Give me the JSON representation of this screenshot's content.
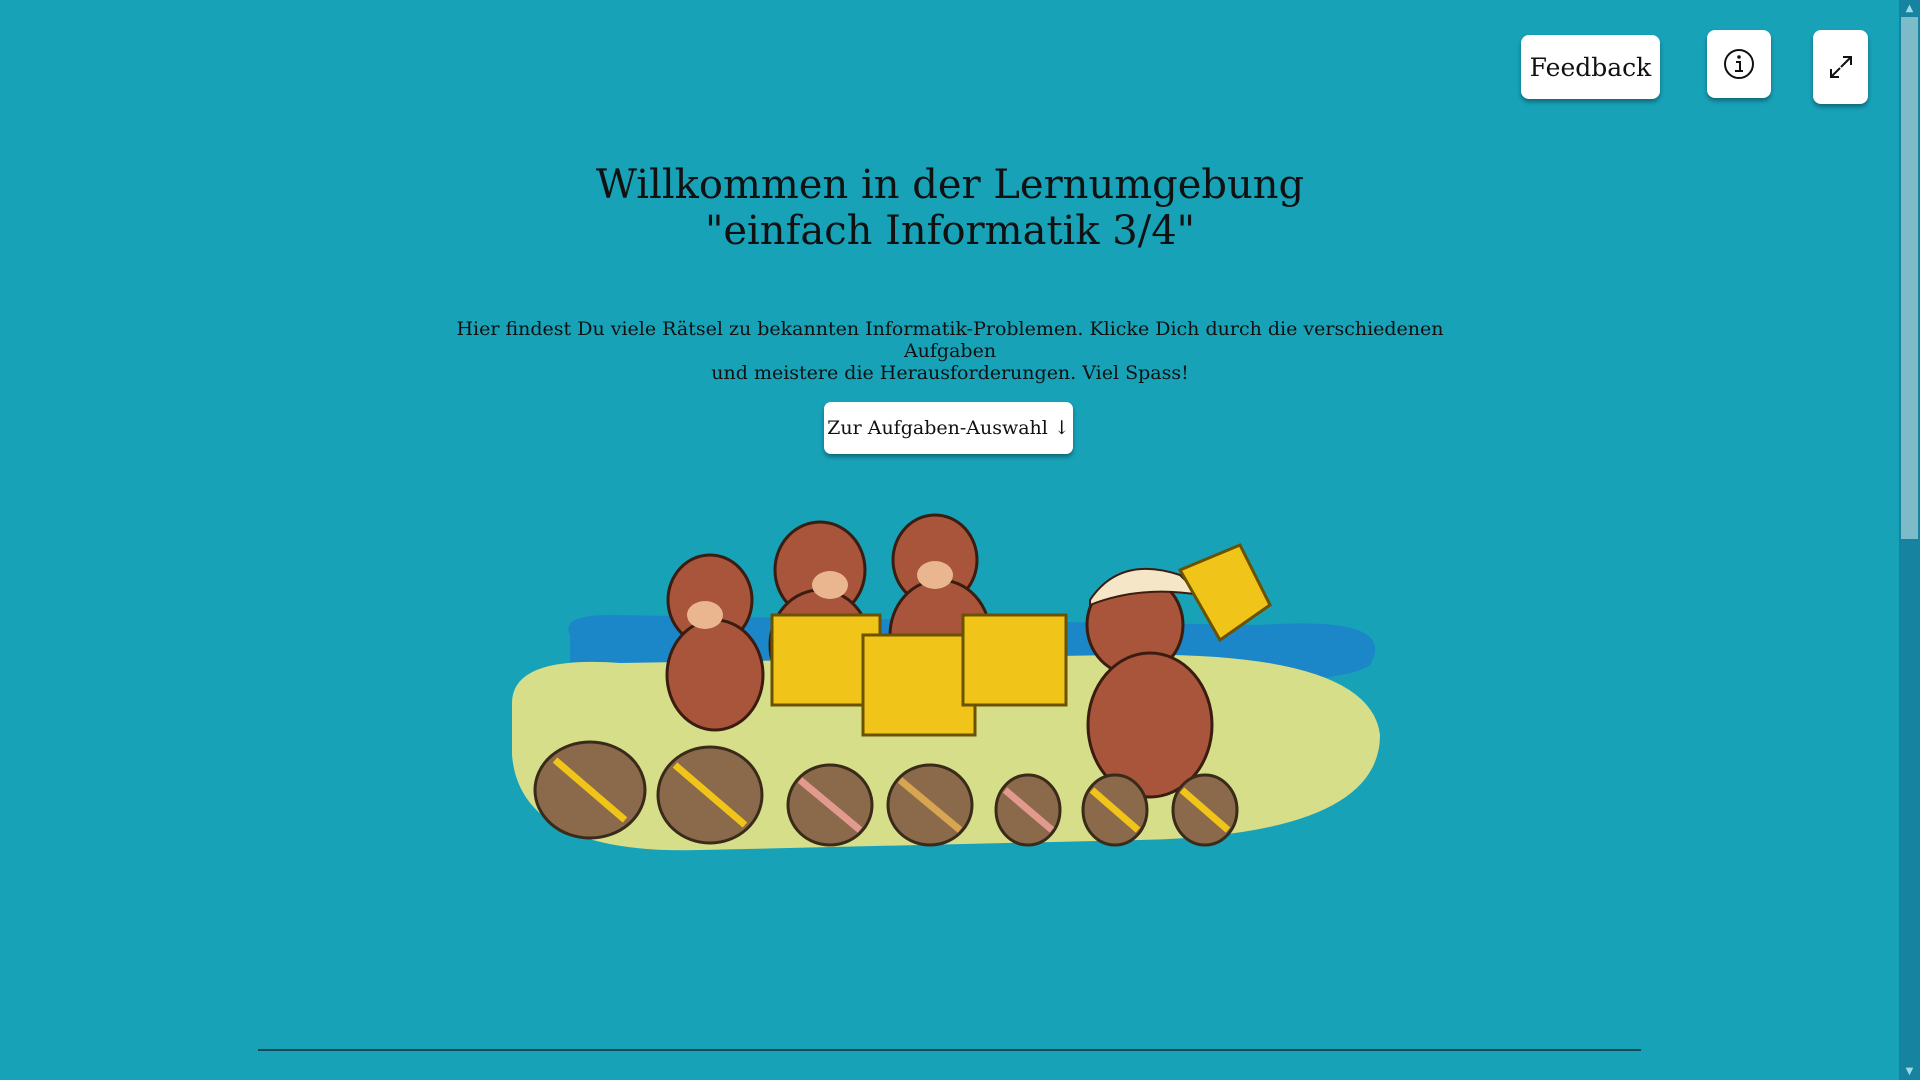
{
  "header": {
    "feedback_label": "Feedback",
    "info_icon": "info-circle-icon",
    "expand_icon": "expand-arrow-icon"
  },
  "main": {
    "title_line1": "Willkommen in der Lernumgebung",
    "title_line2": "\"einfach Informatik 3/4\"",
    "intro_line1": "Hier findest Du viele Rätsel zu bekannten Informatik-Problemen. Klicke Dich durch die verschiedenen Aufgaben",
    "intro_line2": "und meistere die Herausforderungen. Viel Spass!",
    "select_button_label": "Zur Aufgaben-Auswahl ↓"
  },
  "colors": {
    "background": "#17a2b8",
    "island": "#d6de8a",
    "water": "#1b87c9",
    "beaver": "#a8553c",
    "basket": "#f0c419",
    "wood": "#8a6a4a"
  }
}
